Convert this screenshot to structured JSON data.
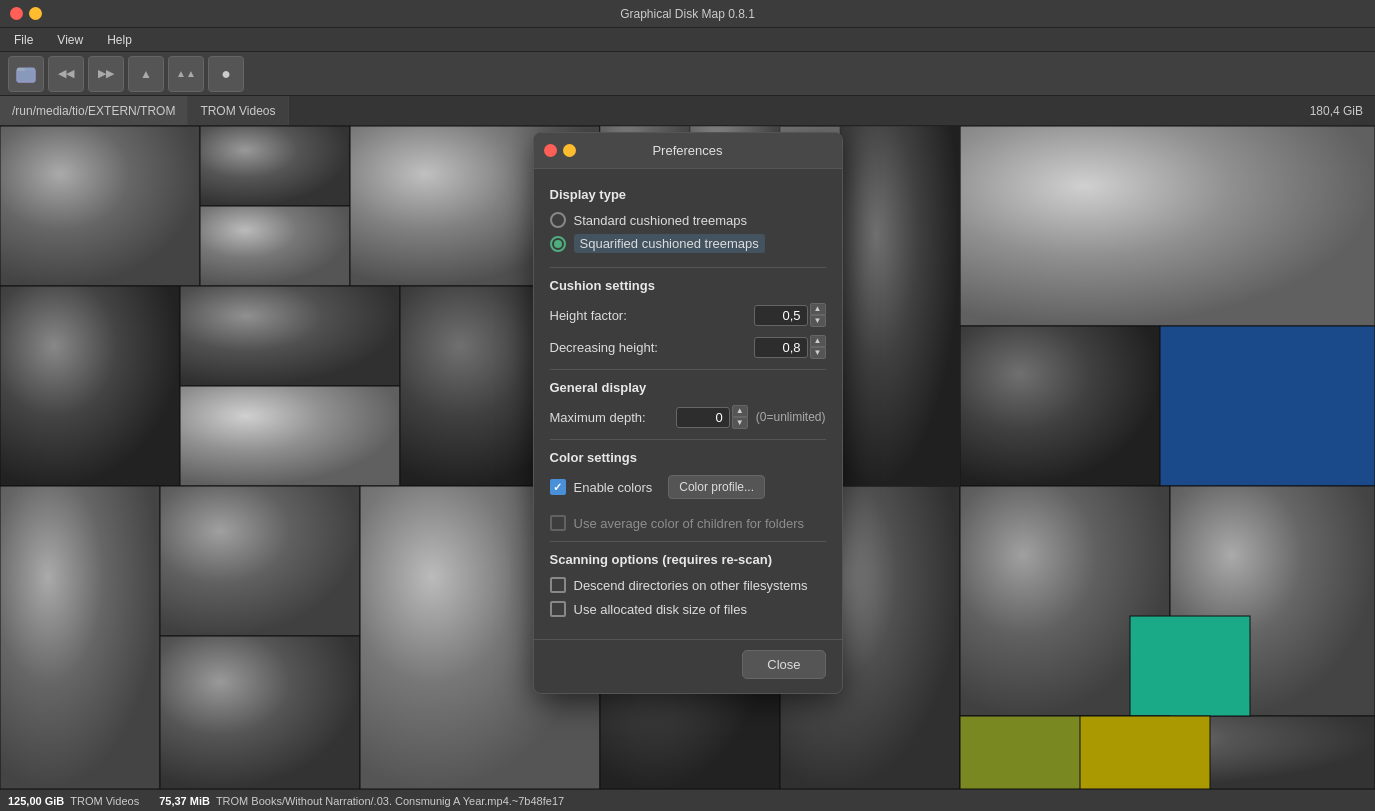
{
  "app": {
    "title": "Graphical Disk Map 0.8.1"
  },
  "titlebar": {
    "btn_close": "close",
    "btn_minimize": "minimize",
    "btn_maximize": "maximize"
  },
  "menubar": {
    "items": [
      "File",
      "View",
      "Help"
    ]
  },
  "toolbar": {
    "buttons": [
      {
        "name": "open-button",
        "icon": "📂"
      },
      {
        "name": "back-button",
        "icon": "◀◀"
      },
      {
        "name": "forward-button",
        "icon": "▶▶"
      },
      {
        "name": "up-button",
        "icon": "▲"
      },
      {
        "name": "up2-button",
        "icon": "▲▲"
      },
      {
        "name": "scan-button",
        "icon": "●"
      }
    ]
  },
  "pathbar": {
    "items": [
      "/run/media/tio/EXTERN/TROM",
      "TROM Videos"
    ],
    "size": "180,4 GiB"
  },
  "statusbar": {
    "item1_size": "125,00 GiB",
    "item1_label": "TROM Videos",
    "item2_size": "75,37 MiB",
    "item2_label": "TROM Books/Without Narration/.03. Consmunig A Year.mp4.~7b48fe17"
  },
  "dialog": {
    "title": "Preferences",
    "sections": {
      "display_type": {
        "label": "Display type",
        "options": [
          {
            "id": "standard",
            "label": "Standard cushioned treemaps",
            "checked": false
          },
          {
            "id": "squarified",
            "label": "Squarified cushioned treemaps",
            "checked": true
          }
        ]
      },
      "cushion_settings": {
        "label": "Cushion settings",
        "fields": [
          {
            "label": "Height factor:",
            "value": "0,5"
          },
          {
            "label": "Decreasing height:",
            "value": "0,8"
          }
        ]
      },
      "general_display": {
        "label": "General display",
        "fields": [
          {
            "label": "Maximum depth:",
            "value": "0",
            "hint": "(0=unlimited)"
          }
        ]
      },
      "color_settings": {
        "label": "Color settings",
        "enable_colors_label": "Enable colors",
        "enable_colors_checked": true,
        "color_profile_btn": "Color profile...",
        "avg_color_label": "Use average color of children for folders",
        "avg_color_checked": false,
        "avg_color_disabled": true
      },
      "scanning_options": {
        "label": "Scanning options (requires re-scan)",
        "options": [
          {
            "label": "Descend directories on other filesystems",
            "checked": false
          },
          {
            "label": "Use allocated disk size of files",
            "checked": false
          }
        ]
      }
    },
    "close_btn": "Close"
  }
}
